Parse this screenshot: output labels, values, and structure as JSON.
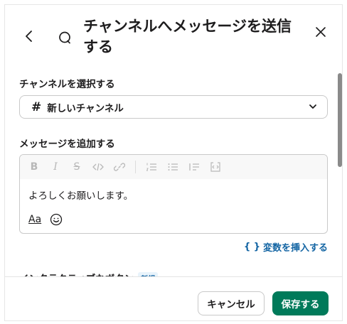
{
  "dialog": {
    "title": "チャンネルへメッセージを送信する"
  },
  "channel_section": {
    "label": "チャンネルを選択する",
    "selected_channel": "新しいチャンネル",
    "hash": "#"
  },
  "message_section": {
    "label": "メッセージを追加する",
    "toolbar": [
      "bold-icon",
      "italic-icon",
      "strikethrough-icon",
      "code-icon",
      "link-icon",
      "ordered-list-icon",
      "bulleted-list-icon",
      "quote-icon",
      "code-block-icon"
    ],
    "toolbar_glyphs": {
      "bold": "B",
      "italic": "I",
      "strike": "S"
    },
    "text": "よろしくお願いします。",
    "format_label": "Aa"
  },
  "insert_variable": {
    "icon": "{ }",
    "label": "変数を挿入する"
  },
  "interactive_buttons": {
    "label": "インタラクティブなボタン",
    "badge": "新規"
  },
  "footer": {
    "cancel_label": "キャンセル",
    "save_label": "保存する"
  },
  "colors": {
    "primary": "#007a5a",
    "link": "#1264a3"
  }
}
